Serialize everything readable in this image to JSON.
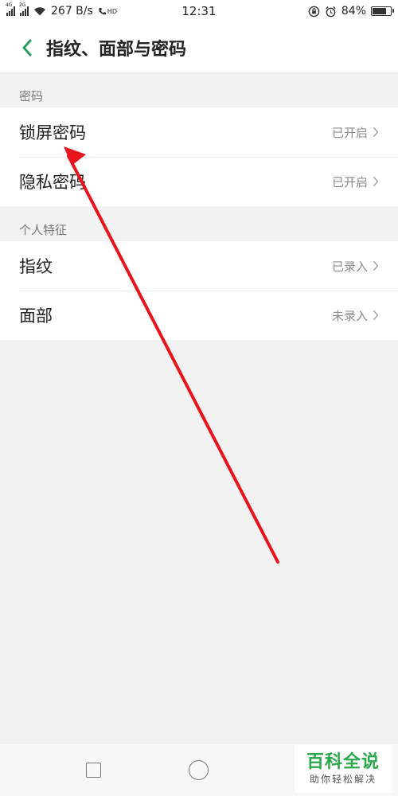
{
  "status_bar": {
    "network_1": "4G",
    "network_2": "2G",
    "speed": "267 B/s",
    "hd_label": "HD",
    "time": "12:31",
    "battery": "84%",
    "battery_level": 0.84,
    "icons": [
      "signal-icon",
      "wifi-icon",
      "hd-call-icon",
      "rotation-lock-icon",
      "alarm-icon",
      "battery-icon"
    ]
  },
  "header": {
    "title": "指纹、面部与密码",
    "back_icon": "chevron-left-icon",
    "accent_color": "#1fa35c"
  },
  "sections": [
    {
      "title": "密码",
      "items": [
        {
          "label": "锁屏密码",
          "status": "已开启"
        },
        {
          "label": "隐私密码",
          "status": "已开启"
        }
      ]
    },
    {
      "title": "个人特征",
      "items": [
        {
          "label": "指纹",
          "status": "已录入"
        },
        {
          "label": "面部",
          "status": "未录入"
        }
      ]
    }
  ],
  "nav_bar": {
    "icons": [
      "recents-square-icon",
      "home-circle-icon"
    ]
  },
  "watermark": {
    "title": "百科全说",
    "subtitle": "助你轻松解决",
    "color": "#2aa84a"
  },
  "annotation": {
    "color": "#e8141c"
  }
}
